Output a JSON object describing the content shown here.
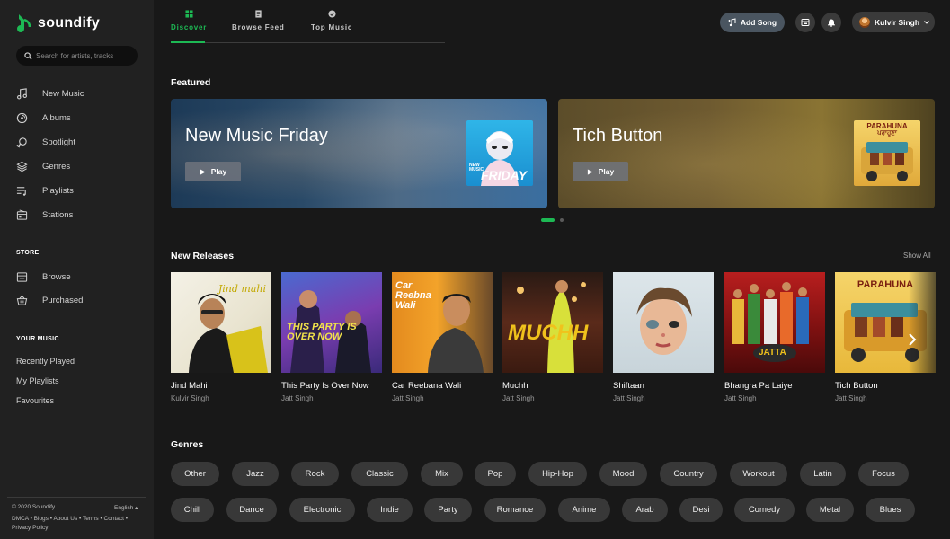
{
  "brand": {
    "name": "soundify",
    "accent": "#1db954"
  },
  "search": {
    "placeholder": "Search for artists, tracks"
  },
  "sidebar": {
    "nav": [
      {
        "label": "New Music",
        "icon": "music-note-icon"
      },
      {
        "label": "Albums",
        "icon": "album-icon"
      },
      {
        "label": "Spotlight",
        "icon": "spotlight-icon"
      },
      {
        "label": "Genres",
        "icon": "layers-icon"
      },
      {
        "label": "Playlists",
        "icon": "playlist-icon"
      },
      {
        "label": "Stations",
        "icon": "radio-icon"
      }
    ],
    "store_label": "STORE",
    "store": [
      {
        "label": "Browse",
        "icon": "store-icon"
      },
      {
        "label": "Purchased",
        "icon": "basket-icon"
      }
    ],
    "your_music_label": "YOUR MUSIC",
    "your_music": [
      "Recently Played",
      "My Playlists",
      "Favourites"
    ],
    "footer": {
      "copyright": "© 2020 Soundify",
      "language": "English ▴",
      "links": "DMCA • Blogs • About Us • Terms • Contact • Privacy Policy"
    }
  },
  "tabs": [
    {
      "label": "Discover",
      "icon": "grid-icon",
      "active": true
    },
    {
      "label": "Browse Feed",
      "icon": "document-icon",
      "active": false
    },
    {
      "label": "Top Music",
      "icon": "disc-icon",
      "active": false
    }
  ],
  "topbar": {
    "add_song": "Add Song",
    "user_name": "Kulvir Singh"
  },
  "featured": {
    "heading": "Featured",
    "cards": [
      {
        "title": "New Music Friday",
        "play": "Play",
        "art_text_1": "NEW MUSIC",
        "art_text_2": "FRIDAY"
      },
      {
        "title": "Tich Button",
        "play": "Play",
        "art_text_1": "PARAHUNA",
        "art_text_2": "ਪਰਾਹੁਣਾ"
      }
    ],
    "slide_index": 1,
    "slide_count": 2
  },
  "new_releases": {
    "heading": "New Releases",
    "show_all": "Show All",
    "items": [
      {
        "title": "Jind Mahi",
        "artist": "Kulvir Singh",
        "art_text": "Jind mahi"
      },
      {
        "title": "This Party Is Over Now",
        "artist": "Jatt Singh",
        "art_text": "THIS PARTY IS OVER NOW"
      },
      {
        "title": "Car Reebana Wali",
        "artist": "Jatt Singh",
        "art_text": "Car Reebna Wali"
      },
      {
        "title": "Muchh",
        "artist": "Jatt Singh",
        "art_text": "MUCHH"
      },
      {
        "title": "Shiftaan",
        "artist": "Jatt Singh",
        "art_text": ""
      },
      {
        "title": "Bhangra Pa Laiye",
        "artist": "Jatt Singh",
        "art_text": "JATTA"
      },
      {
        "title": "Tich Button",
        "artist": "Jatt Singh",
        "art_text": "PARAHUNA"
      }
    ]
  },
  "genres": {
    "heading": "Genres",
    "row1": [
      "Other",
      "Jazz",
      "Rock",
      "Classic",
      "Mix",
      "Pop",
      "Hip-Hop",
      "Mood",
      "Country",
      "Workout",
      "Latin",
      "Focus"
    ],
    "row2": [
      "Chill",
      "Dance",
      "Electronic",
      "Indie",
      "Party",
      "Romance",
      "Anime",
      "Arab",
      "Desi",
      "Comedy",
      "Metal",
      "Blues"
    ]
  }
}
